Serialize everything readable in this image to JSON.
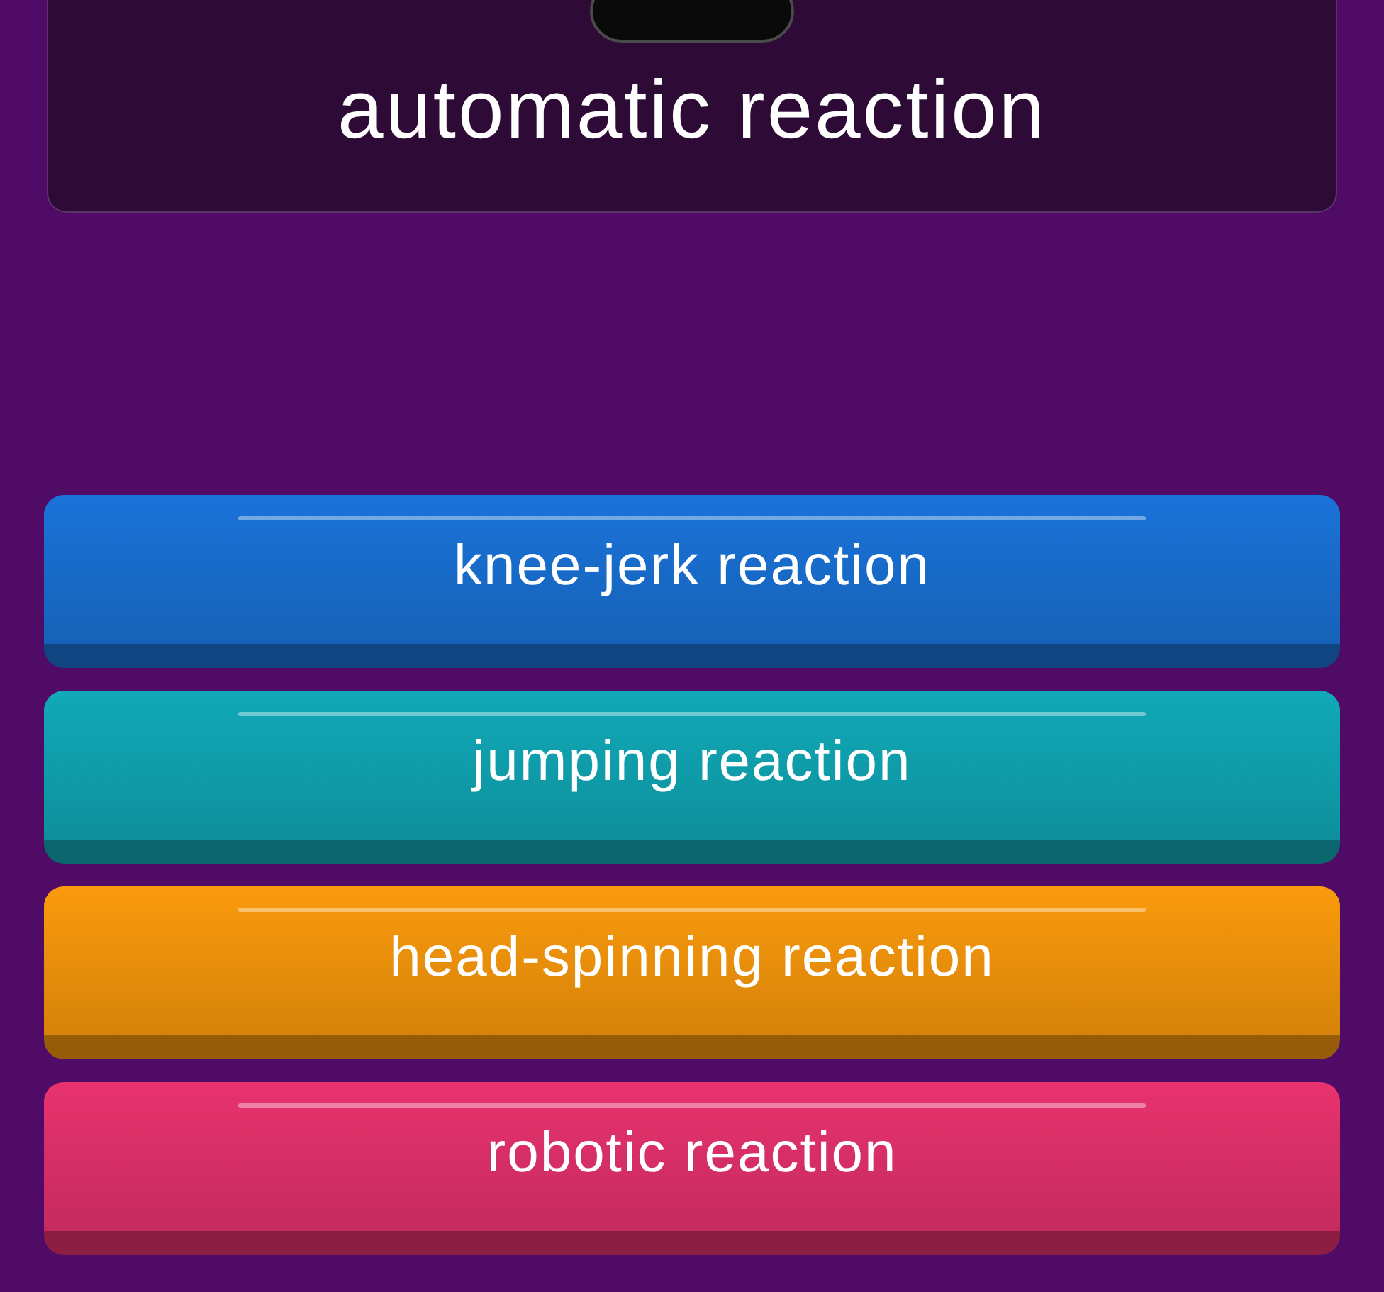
{
  "question": {
    "text": "automatic reaction"
  },
  "options": [
    {
      "label": "knee-jerk reaction",
      "color": "#1a73d9"
    },
    {
      "label": "jumping reaction",
      "color": "#11a9b8"
    },
    {
      "label": "head-spinning reaction",
      "color": "#fb9a0c"
    },
    {
      "label": "robotic reaction",
      "color": "#e8326e"
    }
  ]
}
